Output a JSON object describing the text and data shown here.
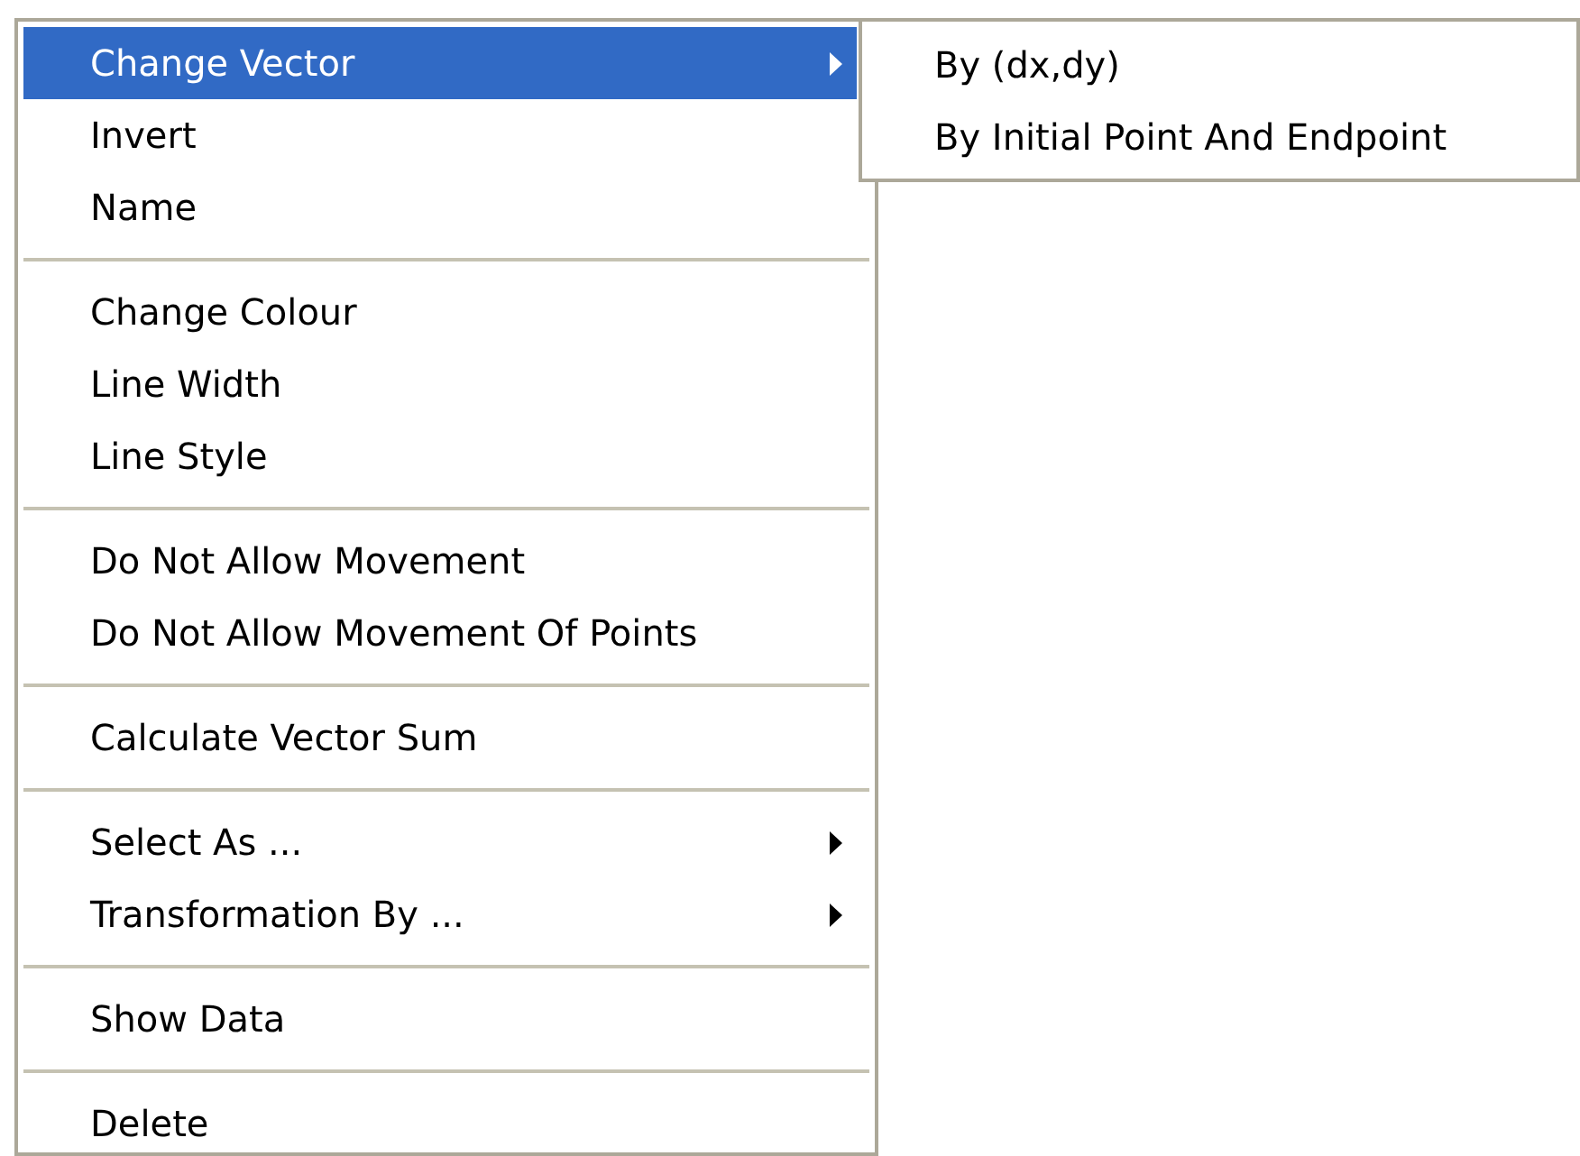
{
  "menu": {
    "items": [
      {
        "kind": "item",
        "label": "Change Vector",
        "selected": true,
        "submenu": true
      },
      {
        "kind": "item",
        "label": "Invert",
        "selected": false,
        "submenu": false
      },
      {
        "kind": "item",
        "label": "Name",
        "selected": false,
        "submenu": false
      },
      {
        "kind": "separator"
      },
      {
        "kind": "item",
        "label": "Change Colour",
        "selected": false,
        "submenu": false
      },
      {
        "kind": "item",
        "label": "Line Width",
        "selected": false,
        "submenu": false
      },
      {
        "kind": "item",
        "label": "Line Style",
        "selected": false,
        "submenu": false
      },
      {
        "kind": "separator"
      },
      {
        "kind": "item",
        "label": "Do Not Allow Movement",
        "selected": false,
        "submenu": false
      },
      {
        "kind": "item",
        "label": "Do Not Allow Movement Of Points",
        "selected": false,
        "submenu": false
      },
      {
        "kind": "separator"
      },
      {
        "kind": "item",
        "label": "Calculate Vector Sum",
        "selected": false,
        "submenu": false
      },
      {
        "kind": "separator"
      },
      {
        "kind": "item",
        "label": "Select As ...",
        "selected": false,
        "submenu": true
      },
      {
        "kind": "item",
        "label": "Transformation By ...",
        "selected": false,
        "submenu": true
      },
      {
        "kind": "separator"
      },
      {
        "kind": "item",
        "label": "Show Data",
        "selected": false,
        "submenu": false
      },
      {
        "kind": "separator"
      },
      {
        "kind": "item",
        "label": "Delete",
        "selected": false,
        "submenu": false
      }
    ]
  },
  "submenu": {
    "items": [
      {
        "label": "By (dx,dy)"
      },
      {
        "label": "By Initial Point And Endpoint"
      }
    ]
  }
}
